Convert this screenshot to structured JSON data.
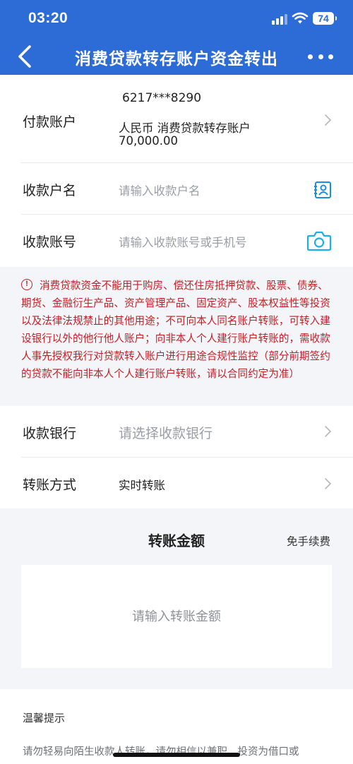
{
  "status_bar": {
    "time": "03:20",
    "battery": "74"
  },
  "nav": {
    "title": "消费贷款转存账户资金转出"
  },
  "payer": {
    "label": "付款账户",
    "account_number": "6217***8290",
    "account_type": "人民币 消费贷款转存账户",
    "balance": "70,000.00"
  },
  "payee_name": {
    "label": "收款户名",
    "placeholder": "请输入收款户名"
  },
  "payee_account": {
    "label": "收款账号",
    "placeholder": "请输入收款账号或手机号"
  },
  "warning": {
    "text": "消费贷款资金不能用于购房、偿还住房抵押贷款、股票、债券、期货、金融衍生产品、资产管理产品、固定资产、股本权益性等投资以及法律法规禁止的其他用途；不可向本人同名账户转账，可转入建设银行以外的他行他人账户；向非本人个人建行账户转账的，需收款人事先授权我行对贷款转入账户进行用途合规性监控（部分前期签约的贷款不能向非本人个人建行账户转账，请以合同约定为准）"
  },
  "bank": {
    "label": "收款银行",
    "placeholder": "请选择收款银行"
  },
  "transfer_method": {
    "label": "转账方式",
    "value": "实时转账"
  },
  "amount": {
    "title": "转账金额",
    "fee_note": "免手续费",
    "placeholder": "请输入转账金额"
  },
  "tips": {
    "title": "温馨提示",
    "text": "请勿轻易向陌生收款人转账，请勿相信以兼职、投资为借口或"
  },
  "colors": {
    "brand_blue": "#2d6bd6",
    "warning_red": "#c21f26",
    "icon_blue": "#1e8fd6"
  }
}
